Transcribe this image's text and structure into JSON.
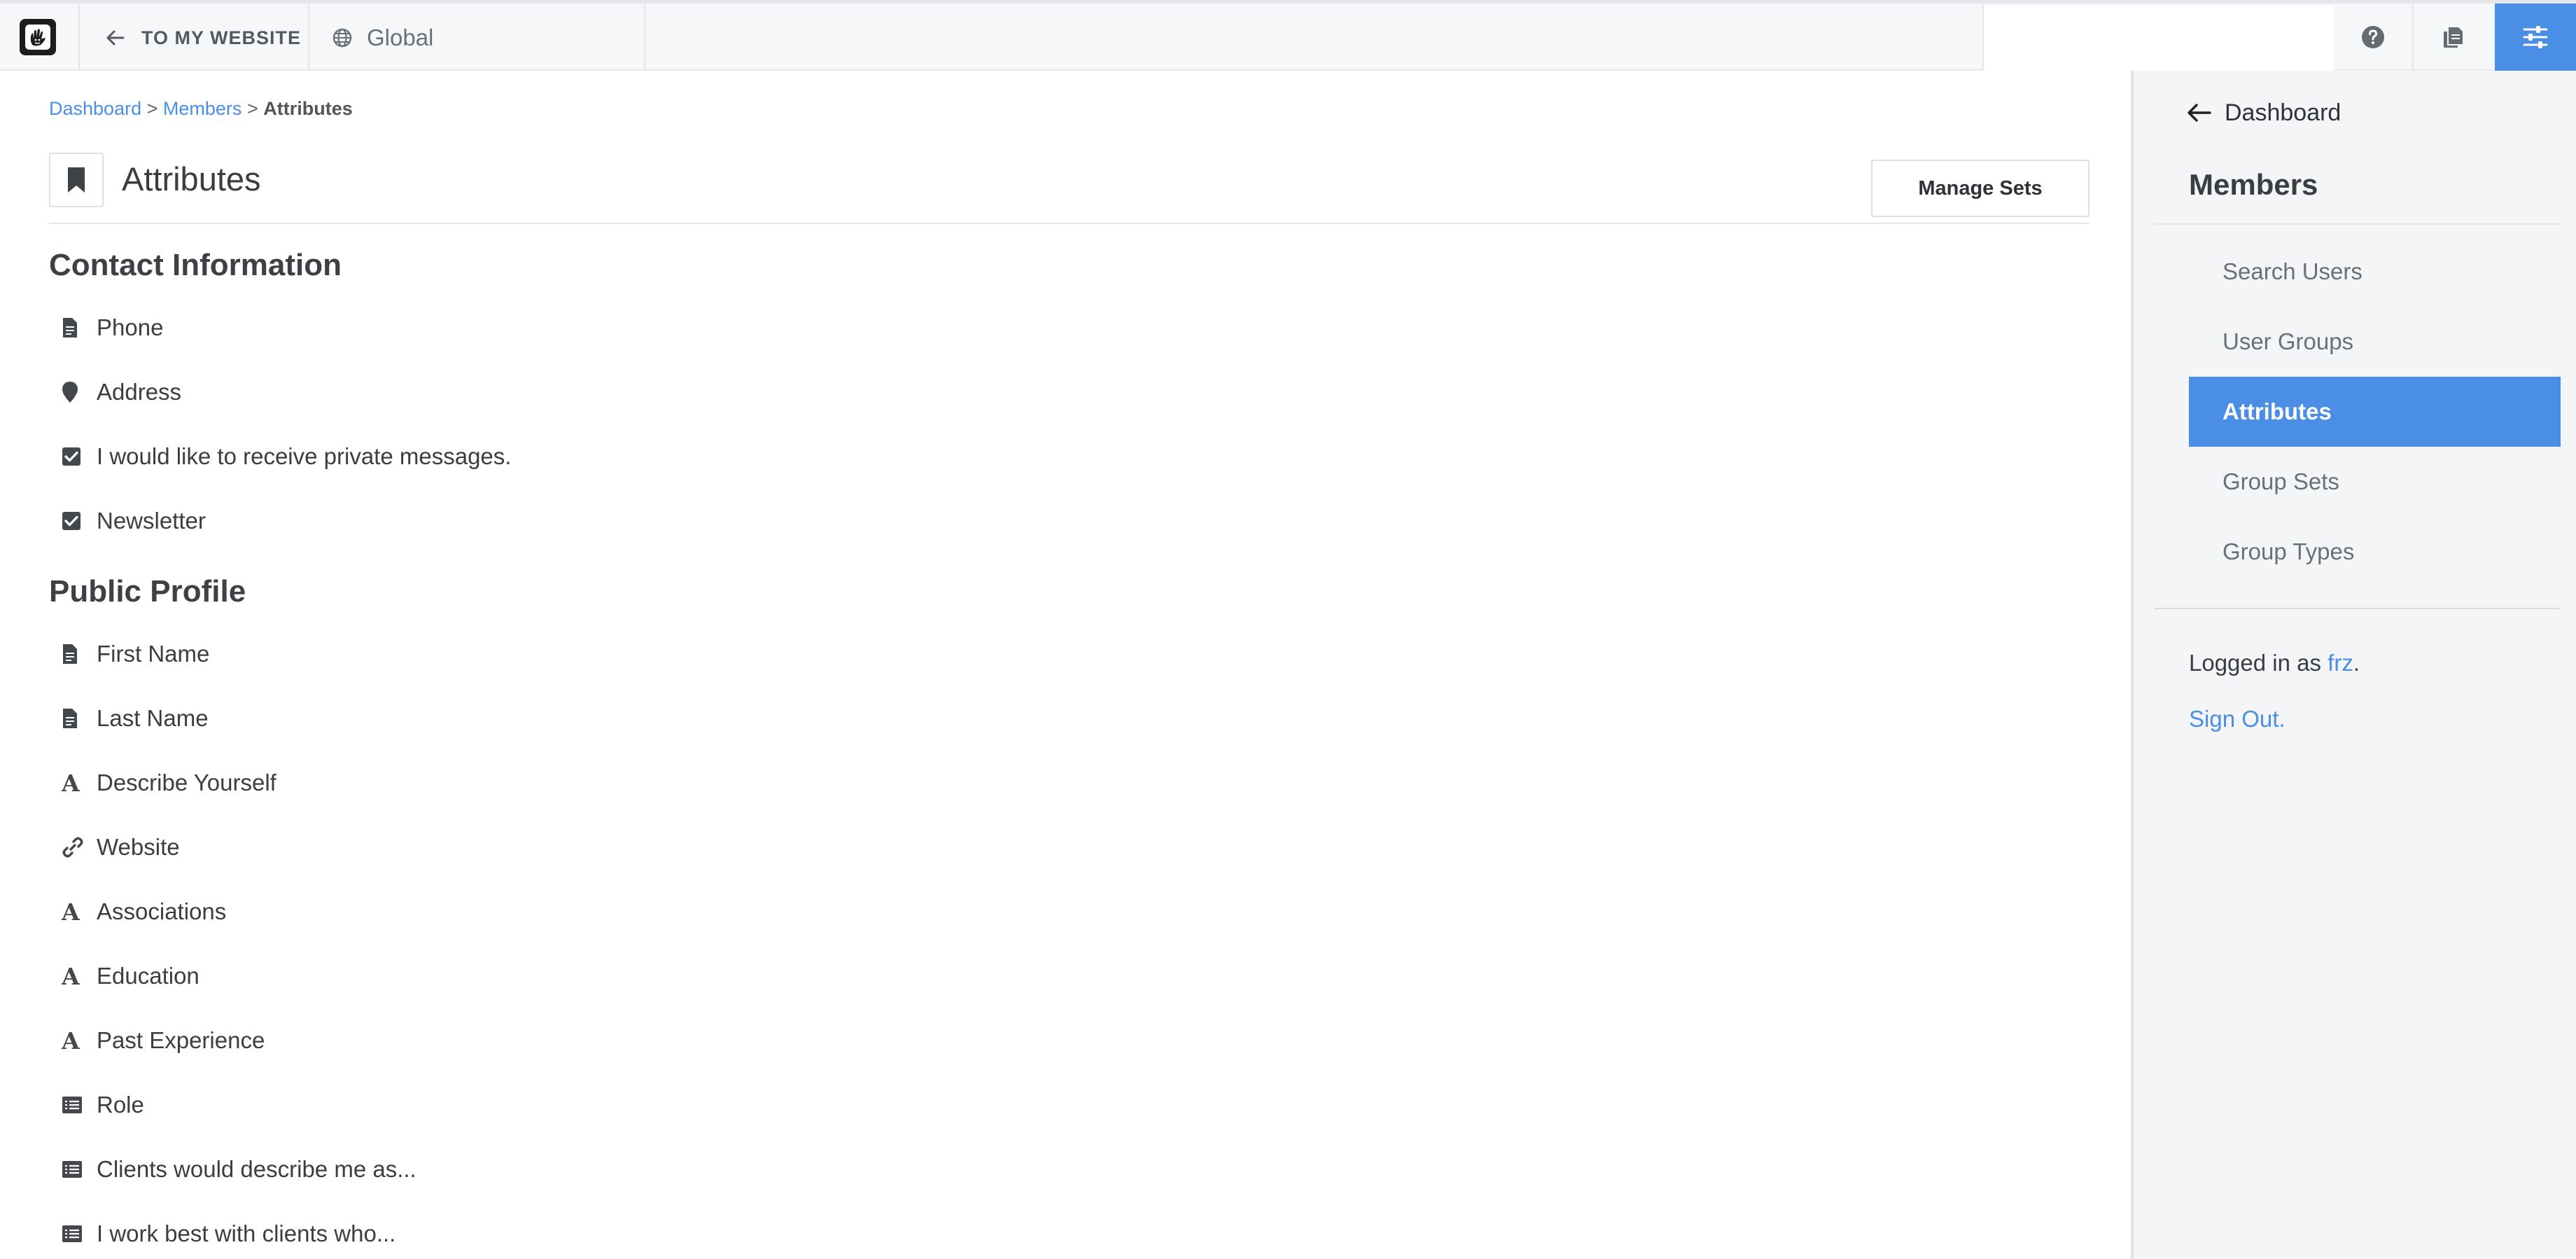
{
  "toolbar": {
    "to_site_label": "TO MY WEBSITE",
    "locale_label": "Global",
    "search_value": ""
  },
  "breadcrumb": {
    "items": [
      "Dashboard",
      "Members",
      "Attributes"
    ],
    "separator": ">"
  },
  "page": {
    "title": "Attributes",
    "manage_sets_label": "Manage Sets"
  },
  "sections": [
    {
      "title": "Contact Information",
      "items": [
        {
          "label": "Phone",
          "icon": "file-icon"
        },
        {
          "label": "Address",
          "icon": "map-marker-icon"
        },
        {
          "label": "I would like to receive private messages.",
          "icon": "checkbox-checked-icon"
        },
        {
          "label": "Newsletter",
          "icon": "checkbox-checked-icon"
        }
      ]
    },
    {
      "title": "Public Profile",
      "items": [
        {
          "label": "First Name",
          "icon": "file-icon"
        },
        {
          "label": "Last Name",
          "icon": "file-icon"
        },
        {
          "label": "Describe Yourself",
          "icon": "font-icon"
        },
        {
          "label": "Website",
          "icon": "link-icon"
        },
        {
          "label": "Associations",
          "icon": "font-icon"
        },
        {
          "label": "Education",
          "icon": "font-icon"
        },
        {
          "label": "Past Experience",
          "icon": "font-icon"
        },
        {
          "label": "Role",
          "icon": "list-icon"
        },
        {
          "label": "Clients would describe me as...",
          "icon": "list-icon"
        },
        {
          "label": "I work best with clients who...",
          "icon": "list-icon"
        }
      ]
    }
  ],
  "panel": {
    "back_label": "Dashboard",
    "title": "Members",
    "nav": [
      {
        "label": "Search Users",
        "active": false
      },
      {
        "label": "User Groups",
        "active": false
      },
      {
        "label": "Attributes",
        "active": true
      },
      {
        "label": "Group Sets",
        "active": false
      },
      {
        "label": "Group Types",
        "active": false
      }
    ],
    "logged_in_prefix": "Logged in as",
    "username": "frz",
    "logged_in_suffix": ".",
    "sign_out_label": "Sign Out."
  },
  "colors": {
    "accent": "#4a8ee5",
    "toolbar_bg": "#f6f7f9",
    "panel_bg": "#f4f5f7",
    "text": "#3a3d42"
  }
}
